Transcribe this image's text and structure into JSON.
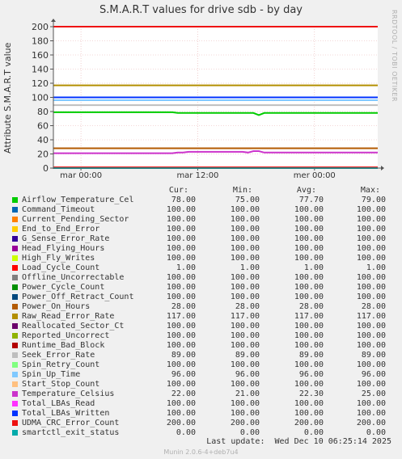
{
  "chart_data": {
    "type": "line",
    "title": "S.M.A.R.T values for drive sdb - by day",
    "ylabel": "Attribute S.M.A.R.T value",
    "ylim": [
      0,
      200
    ],
    "yticks": [
      0,
      20,
      40,
      60,
      80,
      100,
      120,
      140,
      160,
      180,
      200
    ],
    "xticks": [
      "mar 00:00",
      "mar 12:00",
      "mer 00:00"
    ],
    "grid": true,
    "series": [
      {
        "name": "Airflow_Temperature_Cel",
        "color": "#00cc00",
        "cur": "78.00",
        "min": "75.00",
        "avg": "77.70",
        "max": "79.00"
      },
      {
        "name": "Command_Timeout",
        "color": "#0066b3",
        "cur": "100.00",
        "min": "100.00",
        "avg": "100.00",
        "max": "100.00"
      },
      {
        "name": "Current_Pending_Sector",
        "color": "#ff8000",
        "cur": "100.00",
        "min": "100.00",
        "avg": "100.00",
        "max": "100.00"
      },
      {
        "name": "End_to_End_Error",
        "color": "#ffcc00",
        "cur": "100.00",
        "min": "100.00",
        "avg": "100.00",
        "max": "100.00"
      },
      {
        "name": "G_Sense_Error_Rate",
        "color": "#330099",
        "cur": "100.00",
        "min": "100.00",
        "avg": "100.00",
        "max": "100.00"
      },
      {
        "name": "Head_Flying_Hours",
        "color": "#990099",
        "cur": "100.00",
        "min": "100.00",
        "avg": "100.00",
        "max": "100.00"
      },
      {
        "name": "High_Fly_Writes",
        "color": "#ccff00",
        "cur": "100.00",
        "min": "100.00",
        "avg": "100.00",
        "max": "100.00"
      },
      {
        "name": "Load_Cycle_Count",
        "color": "#ff0000",
        "cur": "1.00",
        "min": "1.00",
        "avg": "1.00",
        "max": "1.00"
      },
      {
        "name": "Offline_Uncorrectable",
        "color": "#808080",
        "cur": "100.00",
        "min": "100.00",
        "avg": "100.00",
        "max": "100.00"
      },
      {
        "name": "Power_Cycle_Count",
        "color": "#008f00",
        "cur": "100.00",
        "min": "100.00",
        "avg": "100.00",
        "max": "100.00"
      },
      {
        "name": "Power_Off_Retract_Count",
        "color": "#00487d",
        "cur": "100.00",
        "min": "100.00",
        "avg": "100.00",
        "max": "100.00"
      },
      {
        "name": "Power_On_Hours",
        "color": "#b35a00",
        "cur": "28.00",
        "min": "28.00",
        "avg": "28.00",
        "max": "28.00"
      },
      {
        "name": "Raw_Read_Error_Rate",
        "color": "#b38f00",
        "cur": "117.00",
        "min": "117.00",
        "avg": "117.00",
        "max": "117.00"
      },
      {
        "name": "Reallocated_Sector_Ct",
        "color": "#6b006b",
        "cur": "100.00",
        "min": "100.00",
        "avg": "100.00",
        "max": "100.00"
      },
      {
        "name": "Reported_Uncorrect",
        "color": "#8fb300",
        "cur": "100.00",
        "min": "100.00",
        "avg": "100.00",
        "max": "100.00"
      },
      {
        "name": "Runtime_Bad_Block",
        "color": "#b30000",
        "cur": "100.00",
        "min": "100.00",
        "avg": "100.00",
        "max": "100.00"
      },
      {
        "name": "Seek_Error_Rate",
        "color": "#bebebe",
        "cur": "89.00",
        "min": "89.00",
        "avg": "89.00",
        "max": "89.00"
      },
      {
        "name": "Spin_Retry_Count",
        "color": "#80ff80",
        "cur": "100.00",
        "min": "100.00",
        "avg": "100.00",
        "max": "100.00"
      },
      {
        "name": "Spin_Up_Time",
        "color": "#80c9ff",
        "cur": "96.00",
        "min": "96.00",
        "avg": "96.00",
        "max": "96.00"
      },
      {
        "name": "Start_Stop_Count",
        "color": "#ffc080",
        "cur": "100.00",
        "min": "100.00",
        "avg": "100.00",
        "max": "100.00"
      },
      {
        "name": "Temperature_Celsius",
        "color": "#cc33cc",
        "cur": "22.00",
        "min": "21.00",
        "avg": "22.30",
        "max": "25.00"
      },
      {
        "name": "Total_LBAs_Read",
        "color": "#ff33ff",
        "cur": "100.00",
        "min": "100.00",
        "avg": "100.00",
        "max": "100.00"
      },
      {
        "name": "Total_LBAs_Written",
        "color": "#0033ff",
        "cur": "100.00",
        "min": "100.00",
        "avg": "100.00",
        "max": "100.00"
      },
      {
        "name": "UDMA_CRC_Error_Count",
        "color": "#ee1111",
        "cur": "200.00",
        "min": "200.00",
        "avg": "200.00",
        "max": "200.00"
      },
      {
        "name": "smartctl_exit_status",
        "color": "#00aaaa",
        "cur": "0.00",
        "min": "0.00",
        "avg": "0.00",
        "max": "0.00"
      }
    ]
  },
  "legend_headers": {
    "cur": "Cur:",
    "min": "Min:",
    "avg": "Avg:",
    "max": "Max:"
  },
  "last_update": "Last update:  Wed Dec 10 06:25:14 2025",
  "footer": "Munin 2.0.6-4+deb7u4",
  "side_credit": "RRDTOOL / TOBI OETIKER"
}
